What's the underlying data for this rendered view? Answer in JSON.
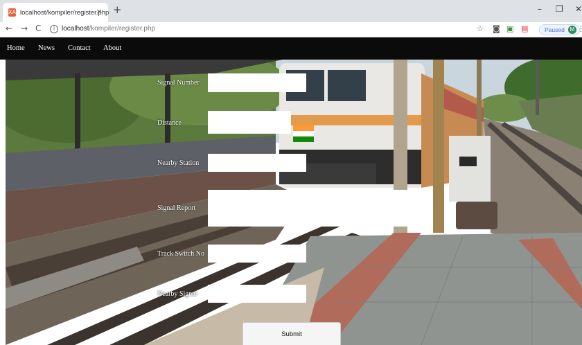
{
  "browser": {
    "tab_title": "localhost/kompiler/register.php",
    "tab_close": "×",
    "new_tab": "+",
    "favicon": "XA",
    "url_host": "localhost",
    "url_path": "/kompiler/register.php",
    "profile_status": "Paused",
    "profile_initial": "M",
    "icons": [
      "back-arrow-icon",
      "forward-arrow-icon",
      "reload-icon",
      "info-icon",
      "star-icon",
      "camera-icon",
      "extension-icon",
      "mail-icon",
      "kebab-menu-icon"
    ]
  },
  "nav": {
    "links": [
      "Home",
      "News",
      "Contact",
      "About"
    ]
  },
  "form": {
    "fields": [
      {
        "label": "Signal Number",
        "value": ""
      },
      {
        "label": "Distance",
        "value": ""
      },
      {
        "label": "Nearby Station",
        "value": ""
      },
      {
        "label": "Signal Report",
        "value": ""
      },
      {
        "label": "Track Switch No",
        "value": ""
      },
      {
        "label": "Nearby Signal",
        "value": ""
      }
    ],
    "submit_label": "Submit"
  },
  "colors": {
    "navbar": "#0b0b0b",
    "accent_profile": "#2e8b57"
  }
}
